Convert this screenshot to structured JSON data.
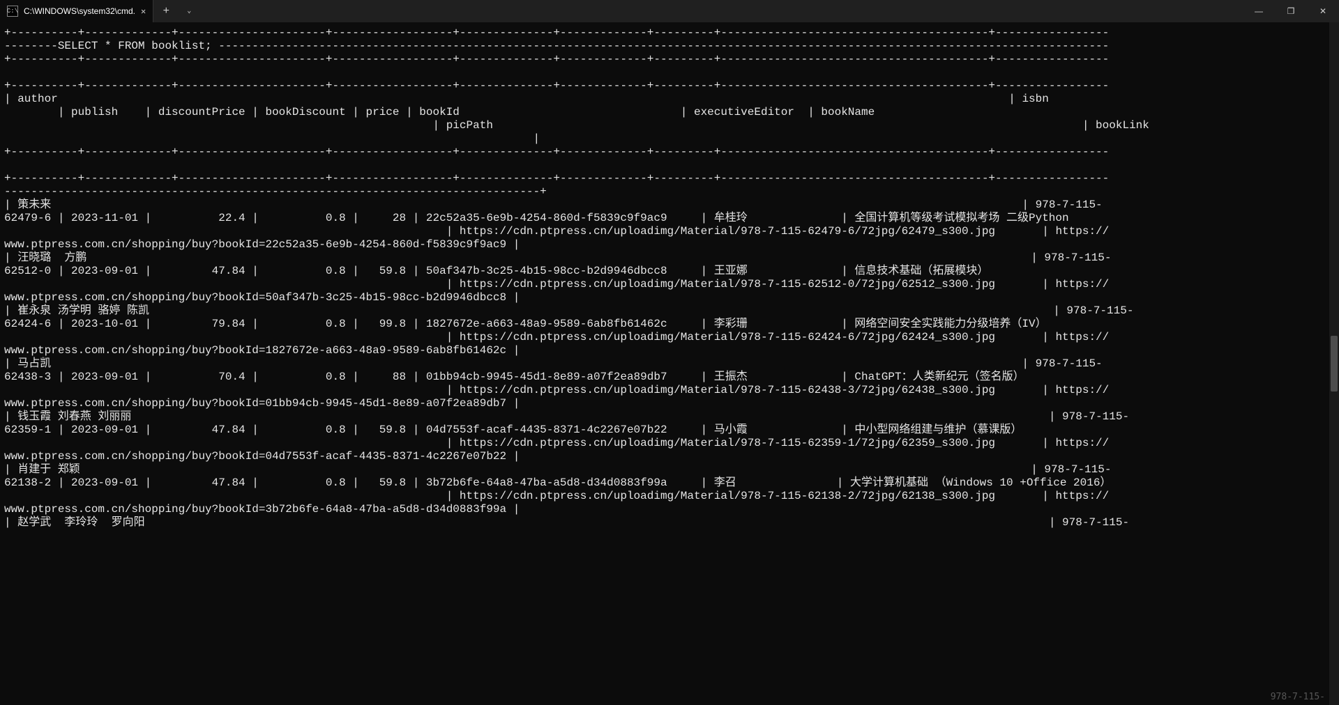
{
  "window": {
    "tab_title": "C:\\WINDOWS\\system32\\cmd.",
    "watermark": "978-7-115-"
  },
  "query": "SELECT * FROM booklist;",
  "columns": [
    "author",
    "isbn",
    "publish",
    "discountPrice",
    "bookDiscount",
    "price",
    "bookId",
    "executiveEditor",
    "bookName",
    "picPath",
    "bookLink"
  ],
  "rows": [
    {
      "author": "策未来",
      "isbn": "978-7-115-62479-6",
      "publish": "2023-11-01",
      "discountPrice": "22.4",
      "bookDiscount": "0.8",
      "price": "28",
      "bookId": "22c52a35-6e9b-4254-860d-f5839c9f9ac9",
      "executiveEditor": "牟桂玲",
      "bookName": "全国计算机等级考试模拟考场 二级Python",
      "picPath": "https://cdn.ptpress.cn/uploadimg/Material/978-7-115-62479-6/72jpg/62479_s300.jpg",
      "bookLink": "https://www.ptpress.com.cn/shopping/buy?bookId=22c52a35-6e9b-4254-860d-f5839c9f9ac9"
    },
    {
      "author": "汪晓璐  方鹏",
      "isbn": "978-7-115-62512-0",
      "publish": "2023-09-01",
      "discountPrice": "47.84",
      "bookDiscount": "0.8",
      "price": "59.8",
      "bookId": "50af347b-3c25-4b15-98cc-b2d9946dbcc8",
      "executiveEditor": "王亚娜",
      "bookName": "信息技术基础（拓展模块）",
      "picPath": "https://cdn.ptpress.cn/uploadimg/Material/978-7-115-62512-0/72jpg/62512_s300.jpg",
      "bookLink": "https://www.ptpress.com.cn/shopping/buy?bookId=50af347b-3c25-4b15-98cc-b2d9946dbcc8"
    },
    {
      "author": "崔永泉 汤学明 骆婷 陈凯",
      "isbn": "978-7-115-62424-6",
      "publish": "2023-10-01",
      "discountPrice": "79.84",
      "bookDiscount": "0.8",
      "price": "99.8",
      "bookId": "1827672e-a663-48a9-9589-6ab8fb61462c",
      "executiveEditor": "李彩珊",
      "bookName": "网络空间安全实践能力分级培养（IV）",
      "picPath": "https://cdn.ptpress.cn/uploadimg/Material/978-7-115-62424-6/72jpg/62424_s300.jpg",
      "bookLink": "https://www.ptpress.com.cn/shopping/buy?bookId=1827672e-a663-48a9-9589-6ab8fb61462c"
    },
    {
      "author": "马占凯",
      "isbn": "978-7-115-62438-3",
      "publish": "2023-09-01",
      "discountPrice": "70.4",
      "bookDiscount": "0.8",
      "price": "88",
      "bookId": "01bb94cb-9945-45d1-8e89-a07f2ea89db7",
      "executiveEditor": "王振杰",
      "bookName": "ChatGPT：人类新纪元（签名版）",
      "picPath": "https://cdn.ptpress.cn/uploadimg/Material/978-7-115-62438-3/72jpg/62438_s300.jpg",
      "bookLink": "https://www.ptpress.com.cn/shopping/buy?bookId=01bb94cb-9945-45d1-8e89-a07f2ea89db7"
    },
    {
      "author": "钱玉霞 刘春燕 刘丽丽",
      "isbn": "978-7-115-62359-1",
      "publish": "2023-09-01",
      "discountPrice": "47.84",
      "bookDiscount": "0.8",
      "price": "59.8",
      "bookId": "04d7553f-acaf-4435-8371-4c2267e07b22",
      "executiveEditor": "马小霞",
      "bookName": "中小型网络组建与维护（慕课版）",
      "picPath": "https://cdn.ptpress.cn/uploadimg/Material/978-7-115-62359-1/72jpg/62359_s300.jpg",
      "bookLink": "https://www.ptpress.com.cn/shopping/buy?bookId=04d7553f-acaf-4435-8371-4c2267e07b22"
    },
    {
      "author": "肖建于 郑颖",
      "isbn": "978-7-115-62138-2",
      "publish": "2023-09-01",
      "discountPrice": "47.84",
      "bookDiscount": "0.8",
      "price": "59.8",
      "bookId": "3b72b6fe-64a8-47ba-a5d8-d34d0883f99a",
      "executiveEditor": "李召",
      "bookName": "大学计算机基础 （Windows 10 +Office 2016）",
      "picPath": "https://cdn.ptpress.cn/uploadimg/Material/978-7-115-62138-2/72jpg/62138_s300.jpg",
      "bookLink": "https://www.ptpress.com.cn/shopping/buy?bookId=3b72b6fe-64a8-47ba-a5d8-d34d0883f99a"
    },
    {
      "author": "赵学武  李玲玲  罗向阳",
      "isbn": "978-7-115-",
      "publish": "",
      "discountPrice": "",
      "bookDiscount": "",
      "price": "",
      "bookId": "",
      "executiveEditor": "",
      "bookName": "",
      "picPath": "",
      "bookLink": ""
    }
  ]
}
